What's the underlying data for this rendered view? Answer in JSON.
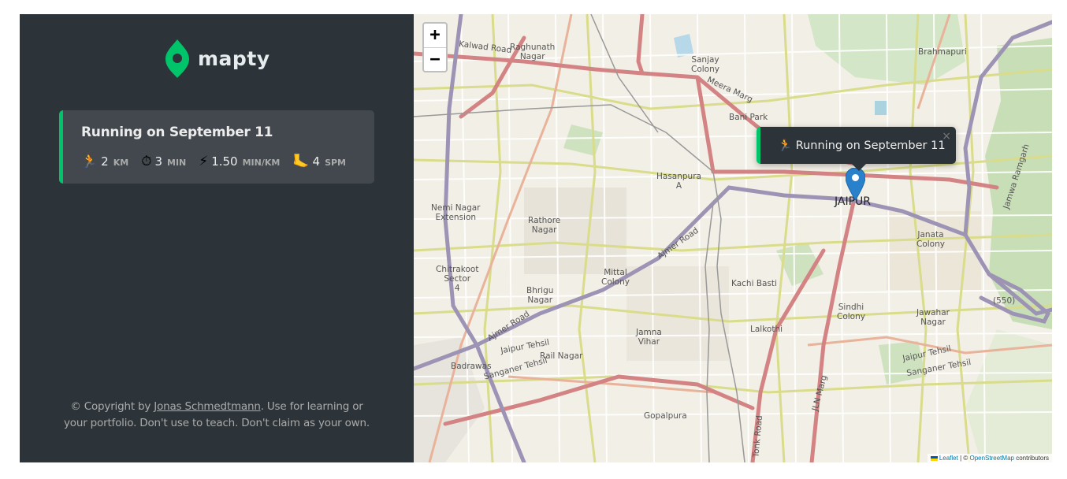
{
  "app": {
    "logo_text": "mapty",
    "brand_color": "#00c46a",
    "sidebar_bg": "#2d3439"
  },
  "workouts": [
    {
      "title": "Running on September 11",
      "type": "running",
      "details": [
        {
          "icon": "runner-icon",
          "glyph": "🏃",
          "value": "2",
          "unit": "KM"
        },
        {
          "icon": "stopwatch-icon",
          "glyph": "⏱",
          "value": "3",
          "unit": "MIN"
        },
        {
          "icon": "lightning-icon",
          "glyph": "⚡",
          "value": "1.50",
          "unit": "MIN/KM"
        },
        {
          "icon": "footprint-icon",
          "glyph": "🦶",
          "value": "4",
          "unit": "SPM"
        }
      ]
    }
  ],
  "copyright": {
    "prefix": "© Copyright by ",
    "author": "Jonas Schmedtmann",
    "suffix": ". Use for learning or your portfolio. Don't use to teach. Don't claim as your own."
  },
  "map": {
    "zoom_in": "+",
    "zoom_out": "−",
    "popup": {
      "glyph": "🏃",
      "text": "Running on September 11",
      "close": "×"
    },
    "attribution": {
      "leaflet": "Leaflet",
      "separator": " | © ",
      "osm": "OpenStreetMap",
      "contributors": " contributors"
    },
    "labels": [
      {
        "text": "Kalwad Road"
      },
      {
        "text": "Raghunath\nNagar"
      },
      {
        "text": "Sanjay\nColony"
      },
      {
        "text": "Meera Marg"
      },
      {
        "text": "Bani Park"
      },
      {
        "text": "Brahmapuri"
      },
      {
        "text": "Hasanpura\nA"
      },
      {
        "text": "Nemi Nagar\nExtension"
      },
      {
        "text": "Rathore\nNagar"
      },
      {
        "text": "JAIPUR"
      },
      {
        "text": "Janata\nColony"
      },
      {
        "text": "Jamwa Ramgarh"
      },
      {
        "text": "Ajmer Road"
      },
      {
        "text": "Chitrakoot\nSector\n4"
      },
      {
        "text": "Mittal\nColony"
      },
      {
        "text": "Kachi Basti"
      },
      {
        "text": "Bhrigu\nNagar"
      },
      {
        "text": "Sindhi\nColony"
      },
      {
        "text": "Jawahar\nNagar"
      },
      {
        "text": "(550)"
      },
      {
        "text": "Lalkothi"
      },
      {
        "text": "Ajmer Road"
      },
      {
        "text": "Jamna\nVihar"
      },
      {
        "text": "Jaipur Tehsil"
      },
      {
        "text": "Rail Nagar"
      },
      {
        "text": "Badrawas"
      },
      {
        "text": "Sanganer Tehsil"
      },
      {
        "text": "Jaipur Tehsil"
      },
      {
        "text": "Sanganer Tehsil"
      },
      {
        "text": "JLN Marg"
      },
      {
        "text": "Gopalpura"
      },
      {
        "text": "Tonk Road"
      }
    ]
  }
}
